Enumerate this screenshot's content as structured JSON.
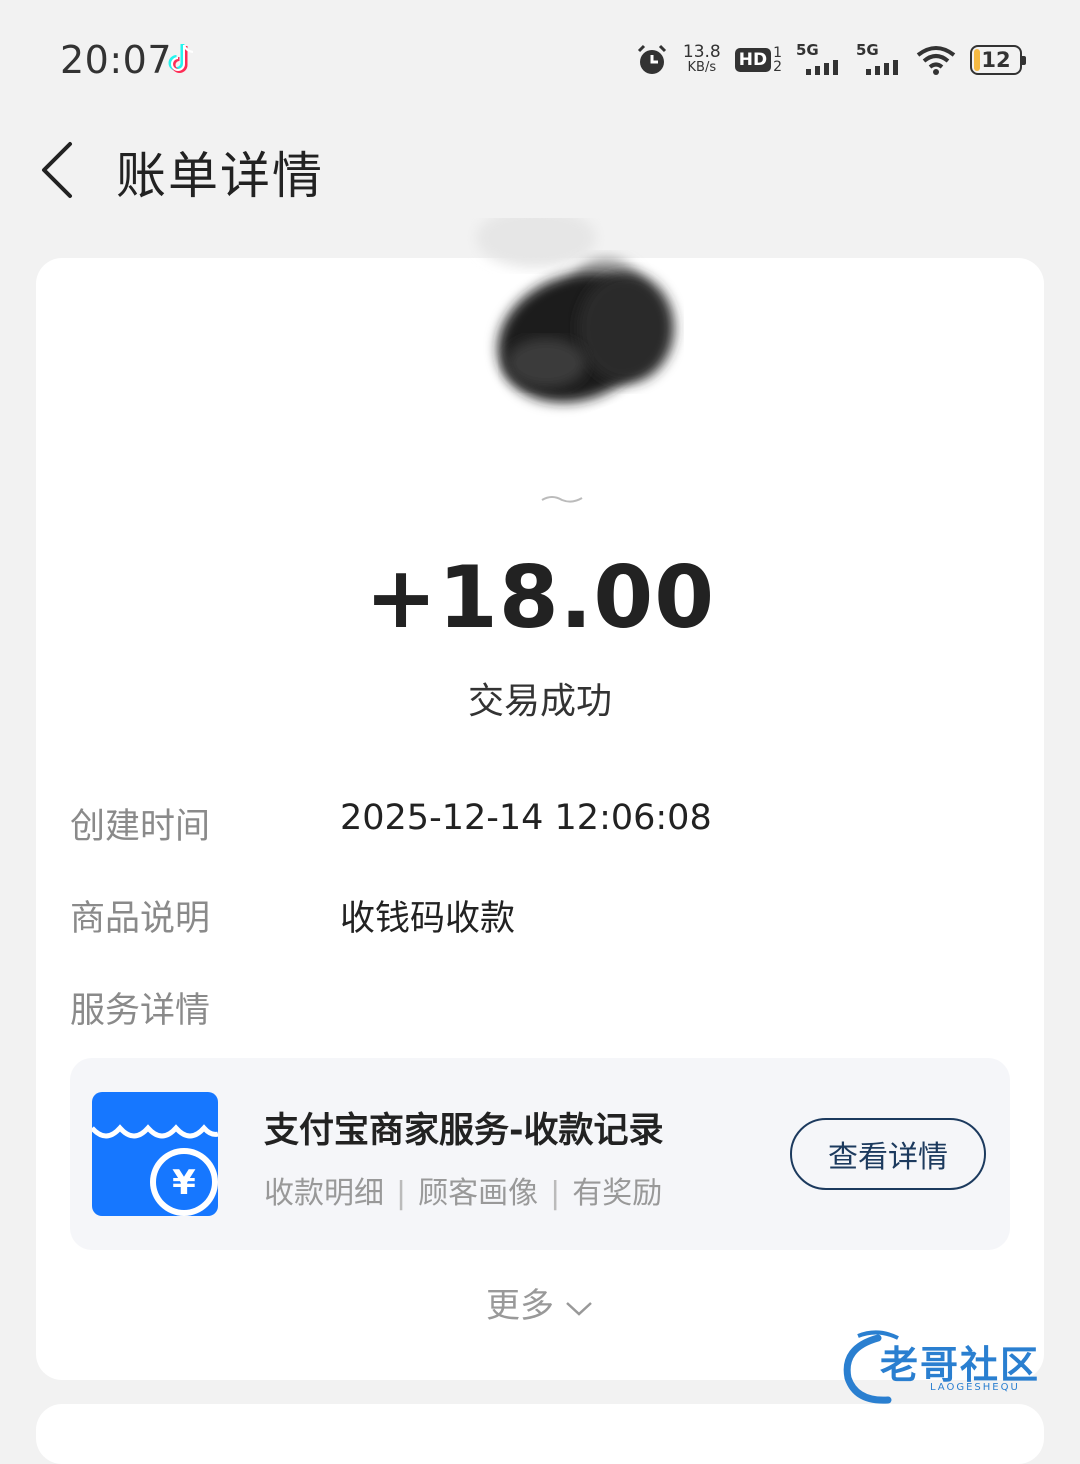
{
  "status_bar": {
    "time": "20:07",
    "net_speed_value": "13.8",
    "net_speed_unit": "KB/s",
    "hd_label": "HD",
    "hd_sim_top": "1",
    "hd_sim_bottom": "2",
    "signal1_label": "5G",
    "signal2_label": "5G",
    "battery_level": "12",
    "icons": [
      "tiktok-icon",
      "alarm-icon",
      "wifi-icon",
      "battery-icon"
    ]
  },
  "header": {
    "title": "账单详情"
  },
  "transaction": {
    "amount": "+18.00",
    "status": "交易成功"
  },
  "details": [
    {
      "label": "创建时间",
      "value": "2025-12-14 12:06:08"
    },
    {
      "label": "商品说明",
      "value": "收钱码收款"
    },
    {
      "label": "服务详情",
      "value": ""
    }
  ],
  "service": {
    "title": "支付宝商家服务-收款记录",
    "tags": [
      "收款明细",
      "顾客画像",
      "有奖励"
    ],
    "separator": "|",
    "button_label": "查看详情",
    "icon": "merchant-store-icon"
  },
  "more": {
    "label": "更多"
  },
  "watermark": {
    "text": "老哥社区",
    "sub": "LAOGESHEQU"
  },
  "colors": {
    "background": "#f2f2f2",
    "card": "#ffffff",
    "service_bg": "#f5f6f9",
    "button_border": "#1c3a5e",
    "icon_blue": "#1677ff",
    "battery": "#f5b942"
  }
}
